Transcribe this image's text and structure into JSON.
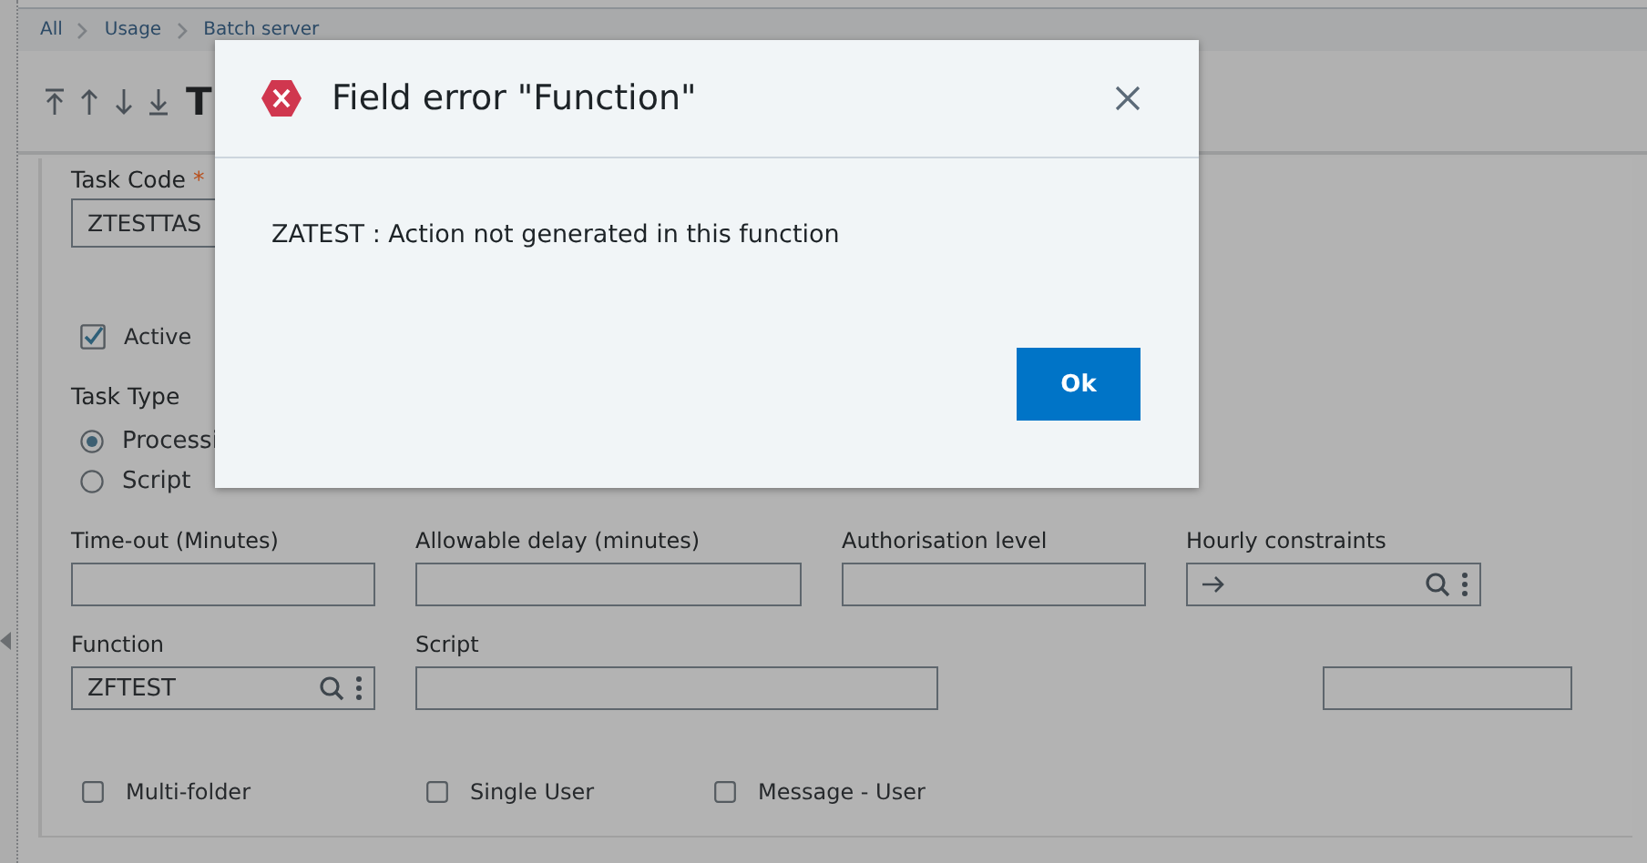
{
  "breadcrumb": [
    "All",
    "Usage",
    "Batch server"
  ],
  "page_title": "T",
  "form": {
    "task_code": {
      "label": "Task Code",
      "required_mark": "*",
      "value": "ZTESTTAS"
    },
    "active": {
      "label": "Active",
      "checked": true
    },
    "task_type": {
      "label": "Task Type",
      "options": [
        {
          "label": "Processi",
          "selected": true
        },
        {
          "label": "Script",
          "selected": false
        }
      ]
    },
    "field_rows": [
      [
        {
          "label": "Time-out (Minutes)",
          "kind": "text"
        },
        {
          "label": "Allowable delay (minutes)",
          "kind": "text"
        },
        {
          "label": "Authorisation level",
          "kind": "text"
        },
        {
          "label": "Hourly constraints",
          "kind": "lookup",
          "arrow": true
        }
      ],
      [
        {
          "label": "Function",
          "kind": "lookup",
          "value": "ZFTEST"
        },
        {
          "label": "Script",
          "kind": "text"
        },
        {
          "kind": "text"
        }
      ]
    ],
    "checkboxes": [
      {
        "label": "Multi-folder",
        "checked": false
      },
      {
        "label": "Single User",
        "checked": false
      },
      {
        "label": "Message - User",
        "checked": false
      }
    ]
  },
  "dialog": {
    "title": "Field error \"Function\"",
    "message": "ZATEST : Action not generated in this function",
    "button": "Ok"
  }
}
